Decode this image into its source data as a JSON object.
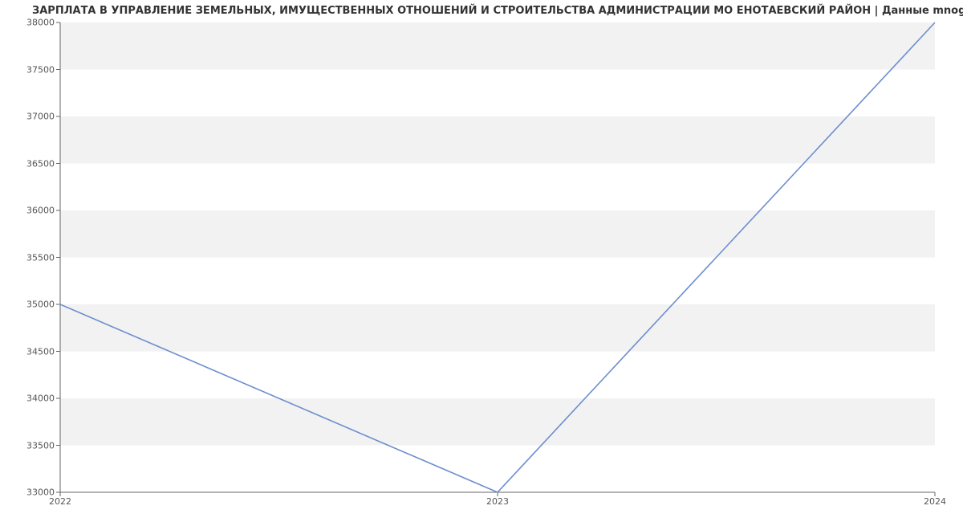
{
  "chart_data": {
    "type": "line",
    "title": "ЗАРПЛАТА В УПРАВЛЕНИЕ ЗЕМЕЛЬНЫХ, ИМУЩЕСТВЕННЫХ ОТНОШЕНИЙ И СТРОИТЕЛЬСТВА АДМИНИСТРАЦИИ МО ЕНОТАЕВСКИЙ РАЙОН | Данные mnogo.work",
    "x": [
      2022,
      2023,
      2024
    ],
    "values": [
      35000,
      33000,
      38000
    ],
    "x_ticks": [
      2022,
      2023,
      2024
    ],
    "y_ticks": [
      33000,
      33500,
      34000,
      34500,
      35000,
      35500,
      36000,
      36500,
      37000,
      37500,
      38000
    ],
    "xlim": [
      2022,
      2024
    ],
    "ylim": [
      33000,
      38000
    ],
    "line_color": "#6c8ecf",
    "band_color": "#f2f2f2",
    "axis_color": "#666666",
    "grid": false
  }
}
